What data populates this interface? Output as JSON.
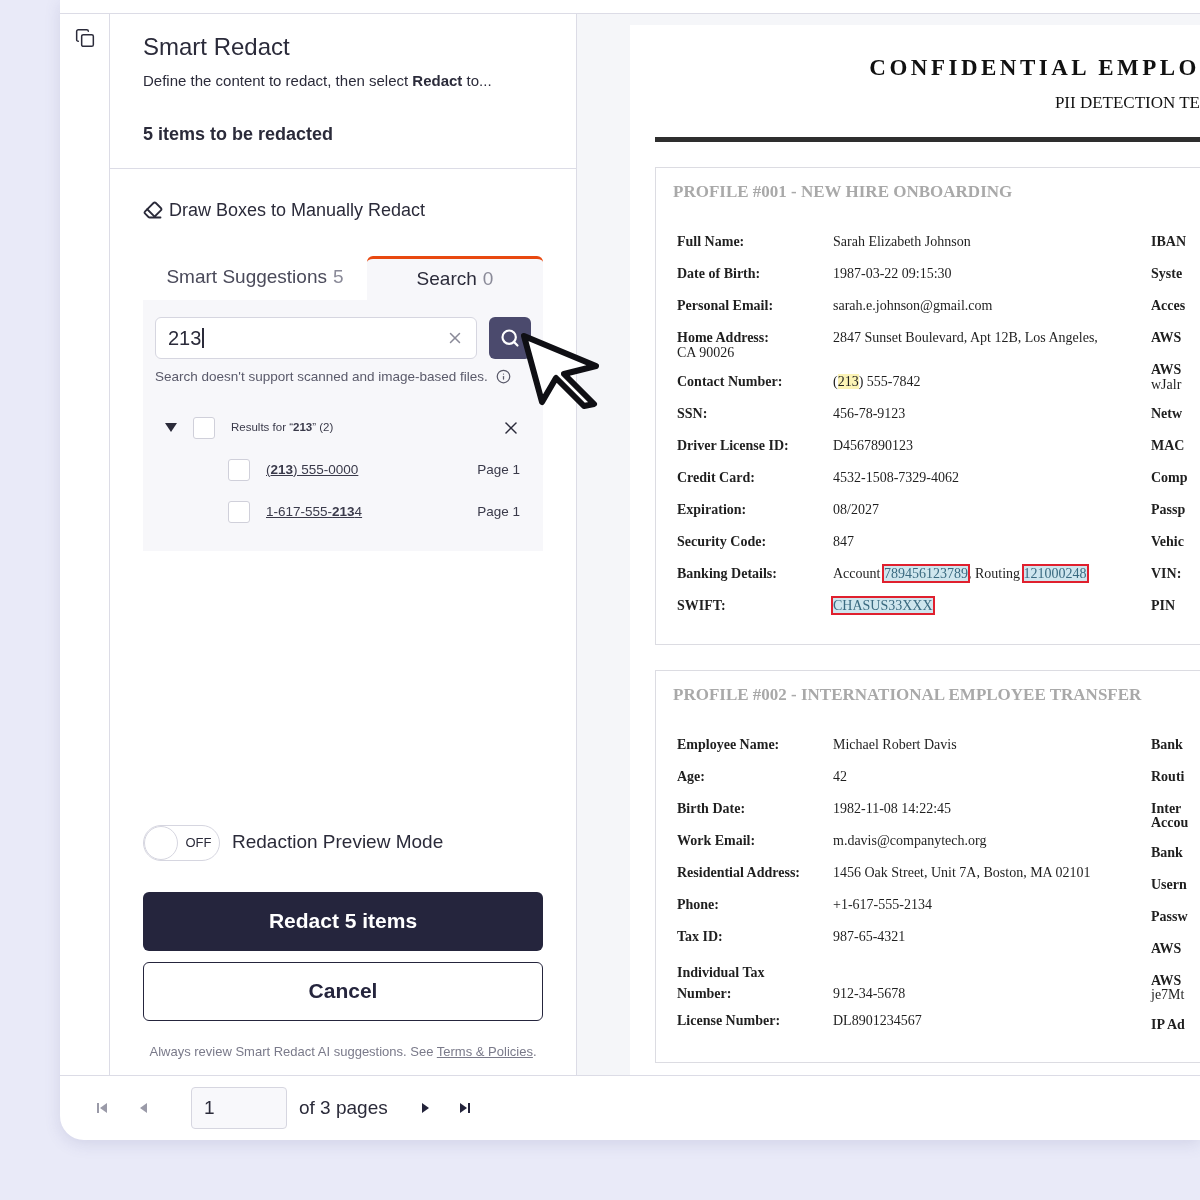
{
  "panel": {
    "title": "Smart Redact",
    "description": "Define the content to redact, then select **Redact** to...",
    "count": "5 items to be redacted",
    "draw_boxes": "Draw Boxes to Manually Redact",
    "tabs": [
      {
        "label": "Smart Suggestions",
        "count": "5",
        "selected": false
      },
      {
        "label": "Search",
        "count": "0",
        "selected": true
      }
    ],
    "search": {
      "value": "213",
      "note": "Search doesn't support scanned and image-based files."
    },
    "results": {
      "label": "Results for “**213**” (2)",
      "expanded": true,
      "checked": false,
      "items": [
        {
          "text": "(**213**) 555-0000",
          "page": "Page 1",
          "checked": false
        },
        {
          "text": "1-617-555-**213**4",
          "page": "Page 1",
          "checked": false
        }
      ]
    },
    "preview": {
      "label": "Redaction Preview Mode",
      "state_text": "OFF",
      "on": false
    },
    "redact_button": "Redact 5 items",
    "cancel_button": "Cancel",
    "disclaimer": "Always review Smart Redact AI suggestions. See ",
    "disclaimer_link": "Terms & Policies",
    "disclaimer_end": "."
  },
  "document": {
    "title": "CONFIDENTIAL EMPLO",
    "subtitle": "PII DETECTION TE",
    "profiles": [
      {
        "heading": "PROFILE #001 - NEW HIRE ONBOARDING",
        "left": [
          {
            "label": "Full Name:",
            "value": "Sarah Elizabeth Johnson"
          },
          {
            "label": "Date of Birth:",
            "value": "1987-03-22 09:15:30"
          },
          {
            "label": "Personal Email:",
            "value": "sarah.e.johnson@gmail.com"
          },
          {
            "label": "Home Address:",
            "value": "2847 Sunset Boulevard, Apt 12B, Los Angeles,",
            "wrap": {
              "text": "CA 90026",
              "kind": "value"
            }
          },
          {
            "label": "Contact Number:",
            "parts": [
              {
                "text": "(",
                "kind": "plain"
              },
              {
                "text": "213",
                "kind": "match"
              },
              {
                "text": ") 555-7842",
                "kind": "plain"
              }
            ]
          },
          {
            "label": "SSN:",
            "value": "456-78-9123"
          },
          {
            "label": "Driver License ID:",
            "value": "D4567890123"
          },
          {
            "label": "Credit Card:",
            "value": "4532-1508-7329-4062"
          },
          {
            "label": "Expiration:",
            "value": "08/2027"
          },
          {
            "label": "Security Code:",
            "value": "847"
          },
          {
            "label": "Banking Details:",
            "parts": [
              {
                "text": "Account ",
                "kind": "plain"
              },
              {
                "text": "789456123789",
                "kind": "redact"
              },
              {
                "text": ", Routing ",
                "kind": "plain"
              },
              {
                "text": "121000248",
                "kind": "redact"
              }
            ]
          },
          {
            "label": "SWIFT:",
            "parts": [
              {
                "text": "CHASUS33XXX",
                "kind": "redact"
              }
            ]
          }
        ],
        "right": [
          {
            "label": "IBAN"
          },
          {
            "label": "Syste"
          },
          {
            "label": "Acces"
          },
          {
            "label": "AWS"
          },
          {
            "label": "AWS",
            "wrap": {
              "text": "wJalr",
              "kind": "value"
            }
          },
          {
            "label": "Netw"
          },
          {
            "label": "MAC"
          },
          {
            "label": "Comp"
          },
          {
            "label": "Passp"
          },
          {
            "label": "Vehic"
          },
          {
            "label": "VIN:"
          },
          {
            "label": "PIN"
          }
        ]
      },
      {
        "heading": "PROFILE #002 - INTERNATIONAL EMPLOYEE TRANSFER",
        "left": [
          {
            "label": "Employee Name:",
            "value": "Michael Robert Davis"
          },
          {
            "label": "Age:",
            "value": "42"
          },
          {
            "label": "Birth Date:",
            "value": "1982-11-08 14:22:45"
          },
          {
            "label": "Work Email:",
            "value": "m.davis@companytech.org"
          },
          {
            "label": "Residential Address:",
            "value": "1456 Oak Street, Unit 7A, Boston, MA 02101"
          },
          {
            "label": "Phone:",
            "value": "+1-617-555-2134"
          },
          {
            "label": "Tax ID:",
            "value": "987-65-4321"
          },
          {
            "label": "Individual Tax",
            "label_wrap": "Number:",
            "value": "912-34-5678"
          },
          {
            "label": "License Number:",
            "value": "DL8901234567"
          }
        ],
        "right": [
          {
            "label": "Bank"
          },
          {
            "label": "Routi"
          },
          {
            "label": "Inter",
            "wrap": {
              "text": "Accou",
              "kind": "label"
            }
          },
          {
            "label": "Bank"
          },
          {
            "label": "Usern"
          },
          {
            "label": "Passw"
          },
          {
            "label": "AWS"
          },
          {
            "label": "AWS",
            "wrap": {
              "text": "je7Mt",
              "kind": "value"
            }
          },
          {
            "label": "IP Ad"
          }
        ]
      }
    ]
  },
  "pager": {
    "page": "1",
    "of": "of 3 pages",
    "buttons": [
      {
        "kind": "first",
        "disabled": true
      },
      {
        "kind": "prev",
        "disabled": true
      },
      {
        "kind": "next",
        "disabled": false
      },
      {
        "kind": "last",
        "disabled": false
      }
    ]
  }
}
